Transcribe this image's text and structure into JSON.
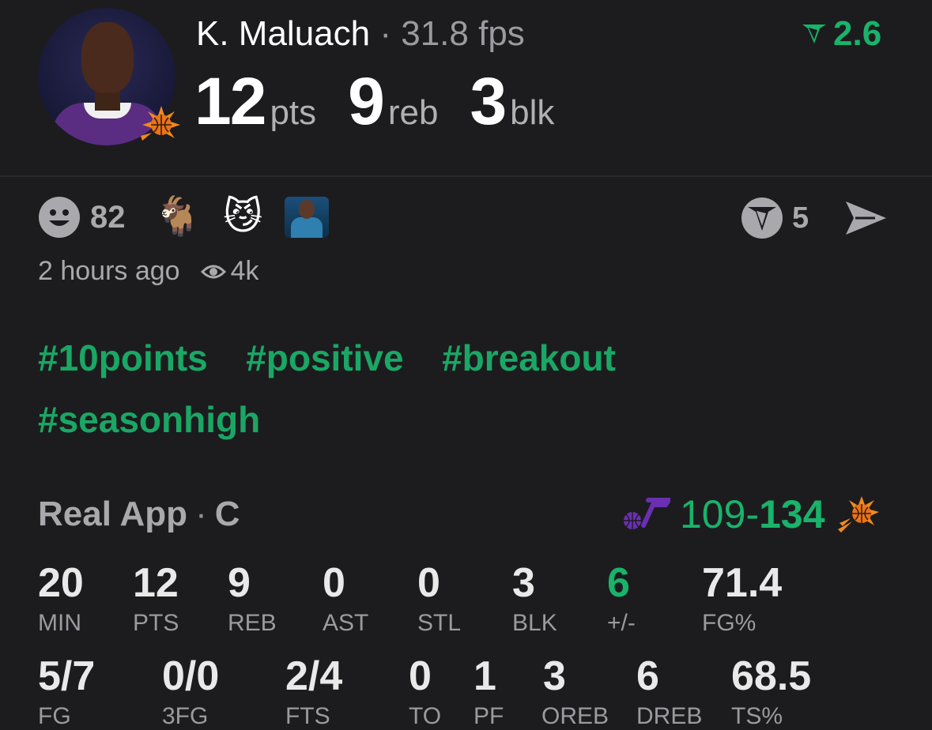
{
  "player": {
    "name": "K. Maluach",
    "separator": "·",
    "fantasy": "31.8 fps",
    "rating": "2.6",
    "big_stats": [
      {
        "value": "12",
        "unit": "pts"
      },
      {
        "value": "9",
        "unit": "reb"
      },
      {
        "value": "3",
        "unit": "blk"
      }
    ]
  },
  "reactions": {
    "smiley_count": "82",
    "emojis": [
      "🐐",
      "😼"
    ],
    "share_count": "5"
  },
  "meta": {
    "time_ago": "2 hours ago",
    "views": "4k"
  },
  "tags": [
    "#10points",
    "#positive",
    "#breakout",
    "#seasonhigh"
  ],
  "source": {
    "app": "Real App",
    "separator": "·",
    "position": "C"
  },
  "game": {
    "opp_score": "109",
    "dash": "-",
    "team_score": "134"
  },
  "stats_row1": [
    {
      "value": "20",
      "label": "MIN"
    },
    {
      "value": "12",
      "label": "PTS"
    },
    {
      "value": "9",
      "label": "REB"
    },
    {
      "value": "0",
      "label": "AST"
    },
    {
      "value": "0",
      "label": "STL"
    },
    {
      "value": "3",
      "label": "BLK"
    },
    {
      "value": "6",
      "label": "+/-"
    },
    {
      "value": "71.4",
      "label": "FG%"
    }
  ],
  "stats_row2": [
    {
      "value": "5/7",
      "label": "FG"
    },
    {
      "value": "0/0",
      "label": "3FG"
    },
    {
      "value": "2/4",
      "label": "FTS"
    },
    {
      "value": "0",
      "label": "TO"
    },
    {
      "value": "1",
      "label": "PF"
    },
    {
      "value": "3",
      "label": "OREB"
    },
    {
      "value": "6",
      "label": "DREB"
    },
    {
      "value": "68.5",
      "label": "TS%"
    }
  ],
  "colors": {
    "accent_green": "#19b36b",
    "tag_green": "#1aa765",
    "background": "#1c1c1e",
    "muted": "#a8a8ad",
    "jazz_purple": "#6b2fb3",
    "suns_orange": "#f08a1c"
  },
  "icons": {
    "rating": "real-rating-icon",
    "reaction": "smiley-icon",
    "share_app": "real-app-icon",
    "send": "send-icon",
    "views": "eye-icon",
    "team": "suns-logo-icon",
    "opponent": "jazz-logo-icon"
  }
}
